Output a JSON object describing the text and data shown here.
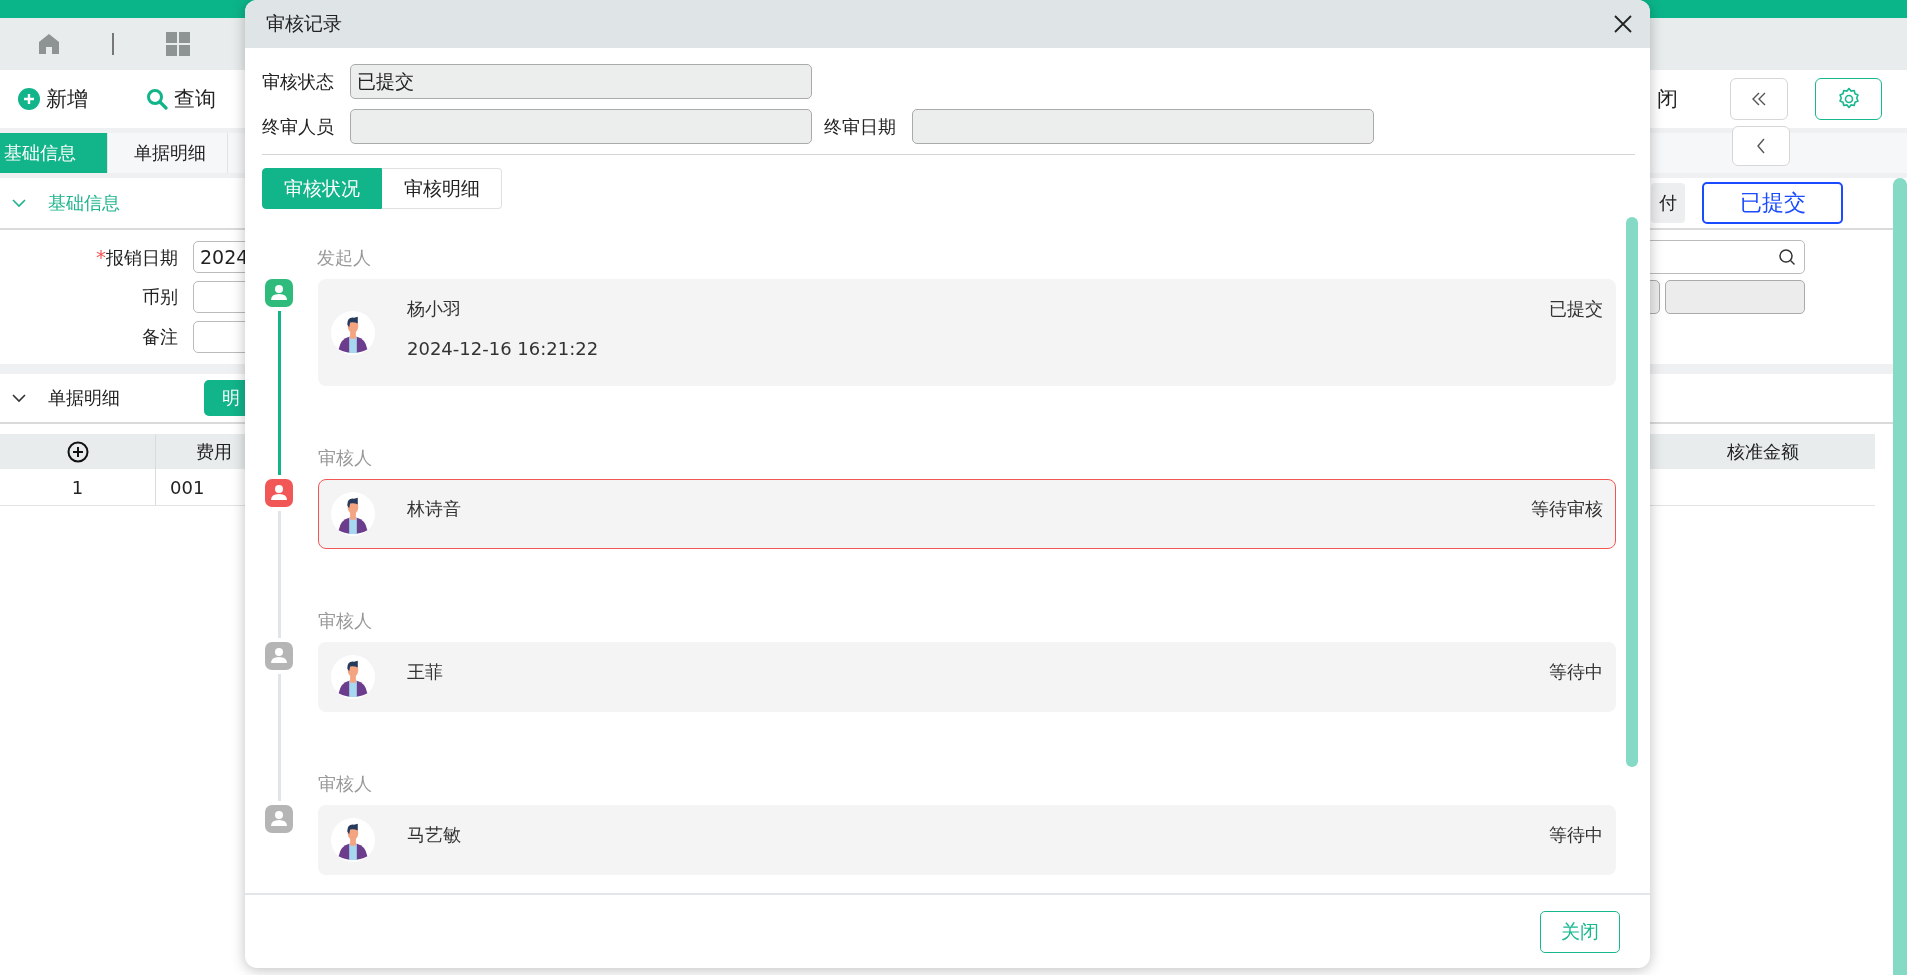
{
  "toolbar": {
    "buttons": [
      {
        "label": "新增",
        "kind": "add"
      },
      {
        "label": "查询",
        "kind": "search"
      }
    ],
    "cut_label": "闭"
  },
  "page_tabs": [
    {
      "label": "基础信息",
      "selected": true
    },
    {
      "label": "单据明细",
      "selected": false
    }
  ],
  "basic_section": {
    "title": "基础信息",
    "expanded": true,
    "badge": "付",
    "status": "已提交",
    "fields": [
      {
        "label": "报销日期",
        "marker": "*",
        "value": "2024"
      },
      {
        "label": "币别"
      },
      {
        "label": "备注"
      }
    ]
  },
  "detail_section": {
    "title": "单据明细",
    "expanded": true,
    "button": "明",
    "table": {
      "columns": [
        {
          "kind": "add"
        },
        {
          "kind": "text",
          "label": "费用"
        },
        {
          "kind": "text",
          "label": "核准金额"
        }
      ],
      "rows": [
        [
          "1",
          "001",
          ""
        ]
      ]
    }
  },
  "dialog": {
    "title": "审核记录",
    "field_rows": [
      [
        {
          "label": "审核状态",
          "value": "已提交"
        }
      ],
      [
        {
          "label": "终审人员"
        },
        {
          "label": "终审日期"
        }
      ]
    ],
    "tabs": [
      {
        "label": "审核状况",
        "selected": true
      },
      {
        "label": "审核明细",
        "selected": false
      }
    ],
    "records": [
      {
        "role": "发起人",
        "name": "杨小羽",
        "time": "2024-12-16 16:21:22",
        "status": "已提交",
        "kind": "done"
      },
      {
        "role": "审核人",
        "name": "林诗音",
        "status": "等待审核",
        "kind": "current"
      },
      {
        "role": "审核人",
        "name": "王菲",
        "status": "等待中",
        "kind": "pending"
      },
      {
        "role": "审核人",
        "name": "马艺敏",
        "status": "等待中",
        "kind": "pending"
      }
    ],
    "close_button": "关闭"
  }
}
